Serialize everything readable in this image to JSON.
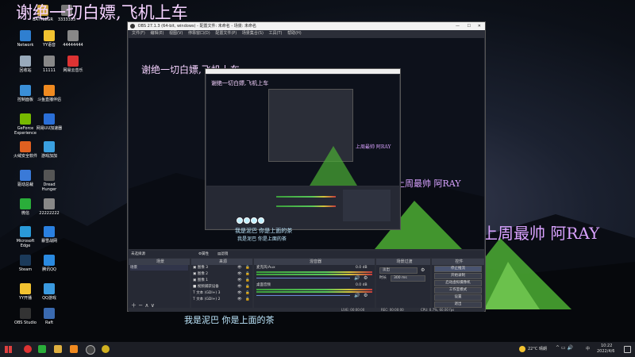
{
  "overlay": {
    "title_big": "谢绝一切白嫖,飞机上车",
    "title_mid": "谢绝一切白嫖,飞机上车",
    "name_big": "上周最帅 阿RAY",
    "name_mid": "上周最帅 阿RAY",
    "name_small": "上周最帅 阿RAY",
    "sub_big": "我是泥巴 你是上面的茶",
    "sub_mid": "我是泥巴 你是上面的茶",
    "sub_small": "我是泥巴 你是上面的茶"
  },
  "desktop": {
    "icons": [
      {
        "label": "BATTLEGR",
        "icon": "game-icon",
        "color": "#c9a23a"
      },
      {
        "label": "3333333",
        "icon": "app-icon",
        "color": "#777"
      },
      {
        "label": "Network",
        "icon": "network-icon",
        "color": "#2f7fd0"
      },
      {
        "label": "YY语音",
        "icon": "yy-icon",
        "color": "#f2c230"
      },
      {
        "label": "44444444",
        "icon": "app-icon",
        "color": "#888"
      },
      {
        "label": "回收站",
        "icon": "recycle-bin-icon",
        "color": "#9ab"
      },
      {
        "label": "11111",
        "icon": "app-icon",
        "color": "#888"
      },
      {
        "label": "网易云音乐",
        "icon": "netease-music-icon",
        "color": "#d33"
      },
      {
        "label": "控制面板",
        "icon": "control-panel-icon",
        "color": "#3a8fd8"
      },
      {
        "label": "斗鱼直播伴侣",
        "icon": "douyu-icon",
        "color": "#f08a20"
      },
      {
        "label": "GeForce Experience",
        "icon": "nvidia-icon",
        "color": "#76b900"
      },
      {
        "label": "网易UU加速器",
        "icon": "uu-icon",
        "color": "#2a6fd8"
      },
      {
        "label": "火绒安全软件",
        "icon": "huorong-icon",
        "color": "#e06020"
      },
      {
        "label": "游戏加加",
        "icon": "game-plus-icon",
        "color": "#3aa0e0"
      },
      {
        "label": "驱动总裁",
        "icon": "driver-icon",
        "color": "#3a7ad8"
      },
      {
        "label": "Dread Hunger",
        "icon": "dread-hunger-icon",
        "color": "#555"
      },
      {
        "label": "微信",
        "icon": "wechat-icon",
        "color": "#2aae3a"
      },
      {
        "label": "22222222",
        "icon": "app-icon",
        "color": "#888"
      },
      {
        "label": "Microsoft Edge",
        "icon": "edge-icon",
        "color": "#2a9ad8"
      },
      {
        "label": "暴雪战网",
        "icon": "battlenet-icon",
        "color": "#2a80e0"
      },
      {
        "label": "Steam",
        "icon": "steam-icon",
        "color": "#1b3a5a"
      },
      {
        "label": "腾讯QQ",
        "icon": "qq-icon",
        "color": "#2a8ae0"
      },
      {
        "label": "YY开播",
        "icon": "yy-live-icon",
        "color": "#f2c230"
      },
      {
        "label": "QQ游戏",
        "icon": "qq-game-icon",
        "color": "#3a9ae0"
      },
      {
        "label": "OBS Studio",
        "icon": "obs-icon",
        "color": "#333"
      },
      {
        "label": "Raft",
        "icon": "raft-icon",
        "color": "#3a6ab0"
      }
    ]
  },
  "obs": {
    "window_title": "OBS 27.1.3 (64-bit, windows) - 配置文件: 未命名 - 场景: 未命名",
    "menu": [
      "文件(F)",
      "编辑(E)",
      "视图(V)",
      "停靠窗口(D)",
      "配置文件(P)",
      "场景集合(S)",
      "工具(T)",
      "帮助(H)"
    ],
    "source_bar": {
      "no_source": "未选择源",
      "properties": "属性",
      "filters": "滤镜"
    },
    "scenes": {
      "header": "场景",
      "items": [
        "场景"
      ]
    },
    "sources": {
      "header": "来源",
      "items": [
        "图像 3",
        "图像 2",
        "图像 1",
        "视频捕获设备",
        "文本 (GDI+) 3",
        "文本 (GDI+) 2"
      ]
    },
    "mixer": {
      "header": "混音器",
      "channels": [
        {
          "name": "麦克风/Aux",
          "db": "0.0 dB"
        },
        {
          "name": "桌面音频",
          "db": "0.0 dB"
        }
      ],
      "ticks": [
        "-60",
        "-50",
        "-40",
        "-30",
        "-20",
        "-10",
        "0"
      ]
    },
    "transitions": {
      "header": "场景过渡",
      "type": "淡出",
      "duration_label": "时长",
      "duration_value": "300 ms"
    },
    "controls": {
      "header": "控件",
      "buttons": [
        "停止推流",
        "开始录制",
        "启动虚拟摄像机",
        "工作室模式",
        "设置",
        "退出"
      ]
    },
    "status": {
      "live": "LIVE: 00:00:00",
      "rec": "REC: 00:00:00",
      "cpu": "CPU: 0.7%, 60.00 fps"
    }
  },
  "taskbar": {
    "weather": "22°C 晴朗",
    "time": "10:22",
    "date": "2022/4/6",
    "ime": "中"
  }
}
